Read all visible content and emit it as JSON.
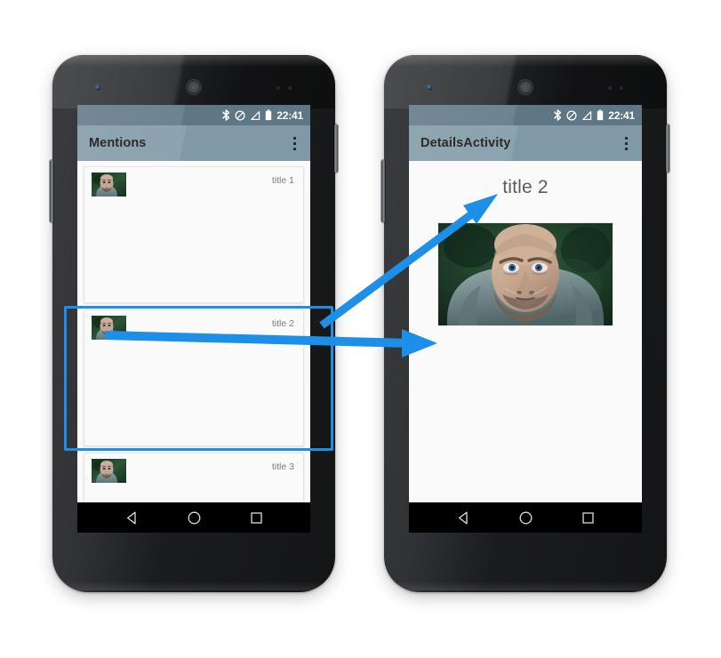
{
  "page": {
    "background_color": "#ffffff",
    "description": "Android shared-element transition diagram: list screen to details screen"
  },
  "colors": {
    "status_bar": "#5f7785",
    "app_bar": "#7f99a6",
    "arrow_blue": "#1e8fe8",
    "highlight_blue": "#1e8fe8",
    "screen_background": "#fafafa",
    "nav_bar": "#000000",
    "card_title_text": "#7b7b7b",
    "details_title_text": "#5c5c5c",
    "app_bar_text": "#2b2b2b"
  },
  "status_bar": {
    "time": "22:41",
    "icons": [
      "bluetooth-icon",
      "do-not-disturb-icon",
      "signal-icon",
      "battery-icon"
    ]
  },
  "nav_bar": {
    "buttons": [
      {
        "name": "back-button",
        "icon": "triangle-left-icon"
      },
      {
        "name": "home-button",
        "icon": "circle-icon"
      },
      {
        "name": "recents-button",
        "icon": "square-icon"
      }
    ]
  },
  "phones": [
    {
      "id": "list-phone",
      "app_bar": {
        "title": "Mentions",
        "overflow_label": "More options"
      },
      "list_items": [
        {
          "title": "title 1",
          "thumbnail": "portrait-thumbnail",
          "selected": false
        },
        {
          "title": "title 2",
          "thumbnail": "portrait-thumbnail",
          "selected": true
        },
        {
          "title": "title 3",
          "thumbnail": "portrait-thumbnail",
          "selected": false
        }
      ]
    },
    {
      "id": "details-phone",
      "app_bar": {
        "title": "DetailsActivity",
        "overflow_label": "More options"
      },
      "details": {
        "title": "title 2",
        "image": "portrait-hero-image"
      }
    }
  ],
  "annotations": {
    "arrows": [
      {
        "name": "title-transition-arrow",
        "from": "list title 2 label",
        "to": "details title 2 heading"
      },
      {
        "name": "image-transition-arrow",
        "from": "list title 2 thumbnail",
        "to": "details hero image"
      }
    ],
    "selection": {
      "name": "selected-item-highlight",
      "target": "title 2 list item"
    }
  }
}
